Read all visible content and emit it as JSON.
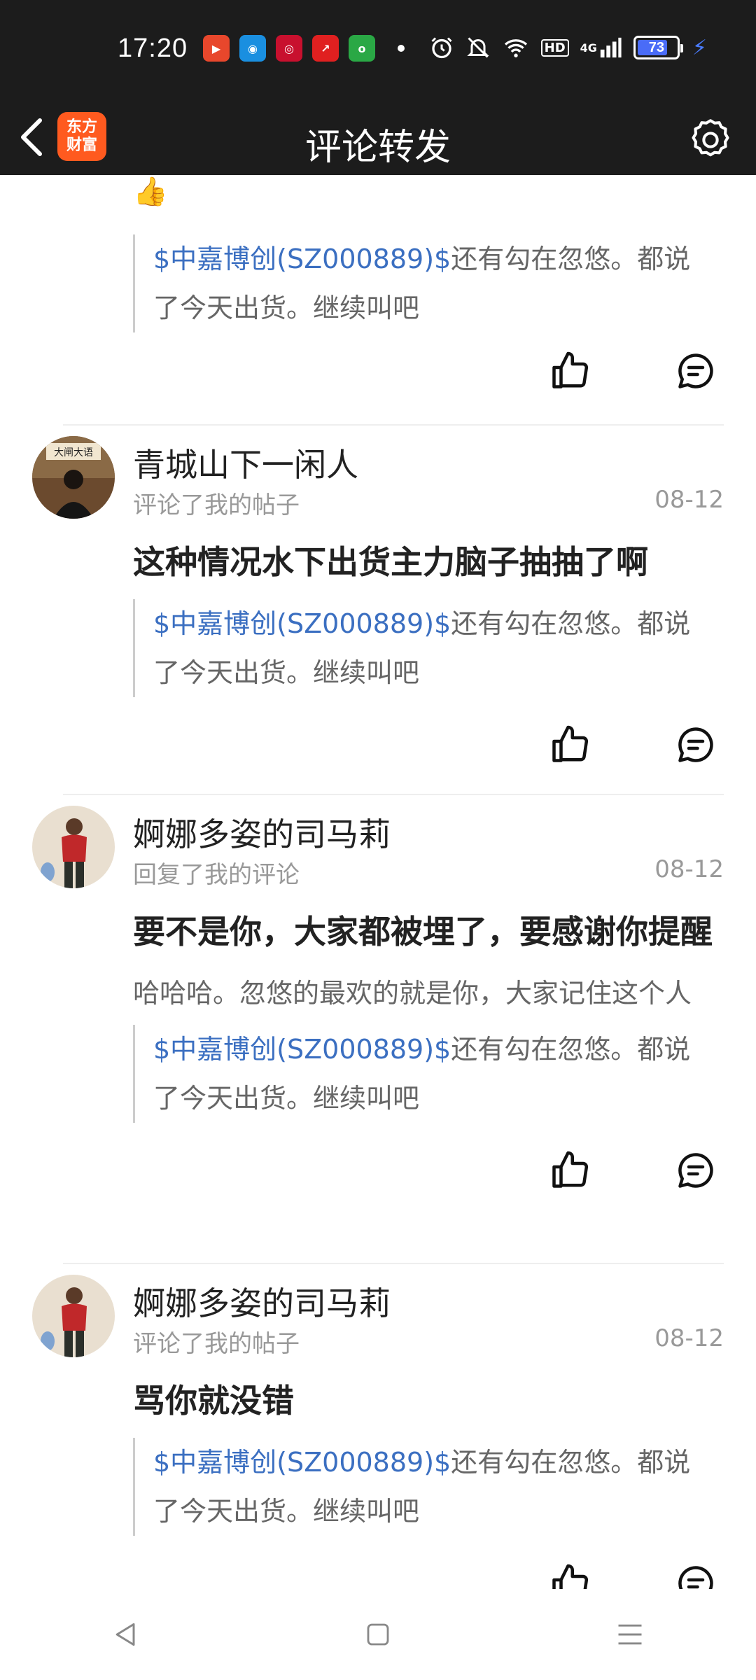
{
  "status_bar": {
    "time": "17:20",
    "battery": "73",
    "signal": "4G",
    "hd": "HD"
  },
  "header": {
    "title": "评论转发",
    "logo_line1": "东方",
    "logo_line2": "财富"
  },
  "feed": {
    "top_partial": {
      "quote_stock": "$中嘉博创(SZ000889)$",
      "quote_rest": "还有勾在忽悠。都说",
      "quote_line2": "了今天出货。继续叫吧"
    },
    "items": [
      {
        "user": "青城山下一闲人",
        "action": "评论了我的帖子",
        "date": "08-12",
        "text": "这种情况水下出货主力脑子抽抽了啊",
        "reply": "",
        "quote_stock": "$中嘉博创(SZ000889)$",
        "quote_rest": "还有勾在忽悠。都说",
        "quote_line2": "了今天出货。继续叫吧"
      },
      {
        "user": "婀娜多姿的司马莉",
        "action": "回复了我的评论",
        "date": "08-12",
        "text": "要不是你，大家都被埋了，要感谢你提醒",
        "reply": "哈哈哈。忽悠的最欢的就是你，大家记住这个人",
        "quote_stock": "$中嘉博创(SZ000889)$",
        "quote_rest": "还有勾在忽悠。都说",
        "quote_line2": "了今天出货。继续叫吧"
      },
      {
        "user": "婀娜多姿的司马莉",
        "action": "评论了我的帖子",
        "date": "08-12",
        "text": "骂你就没错",
        "reply": "",
        "quote_stock": "$中嘉博创(SZ000889)$",
        "quote_rest": "还有勾在忽悠。都说",
        "quote_line2": "了今天出货。继续叫吧"
      }
    ]
  },
  "colors": {
    "header_bg": "#1c1c1c",
    "stock_link": "#3b6fc1",
    "logo": "#ff5a1f"
  }
}
